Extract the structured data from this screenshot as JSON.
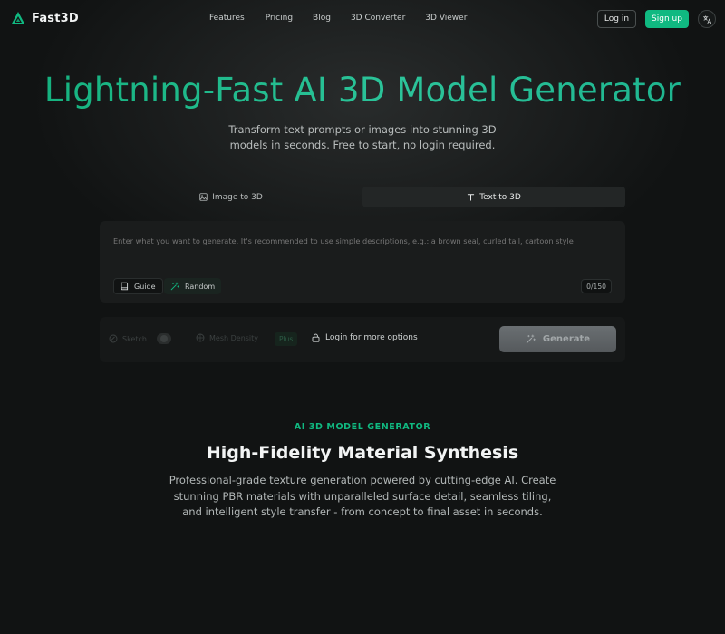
{
  "brand": {
    "name": "Fast3D",
    "logo_icon": "triangle-logo-icon",
    "accent": "#10b981"
  },
  "nav": {
    "links": [
      "Features",
      "Pricing",
      "Blog",
      "3D Converter",
      "3D Viewer"
    ],
    "login_label": "Log in",
    "signup_label": "Sign up",
    "language_icon": "translate-icon"
  },
  "hero": {
    "title": "Lightning-Fast AI 3D Model Generator",
    "subtitle": "Transform text prompts or images into stunning 3D models in seconds. Free to start, no login required."
  },
  "tabs": [
    {
      "label": "Image to 3D",
      "icon": "image-icon",
      "active": false
    },
    {
      "label": "Text to 3D",
      "icon": "text-icon",
      "active": true
    }
  ],
  "prompt": {
    "placeholder": "Enter what you want to generate. It's recommended to use simple descriptions, e.g.: a brown seal, curled tail, cartoon style",
    "value": "",
    "guide_label": "Guide",
    "random_label": "Random",
    "counter": "0/150"
  },
  "options": {
    "sketch_label": "Sketch",
    "mesh_density_label": "Mesh Density",
    "mesh_density_badge": "Plus",
    "login_more_label": "Login for more options",
    "generate_label": "Generate"
  },
  "section": {
    "eyebrow": "AI 3D MODEL GENERATOR",
    "title": "High-Fidelity Material Synthesis",
    "description": "Professional-grade texture generation powered by cutting-edge AI. Create stunning PBR materials with unparalleled surface detail, seamless tiling, and intelligent style transfer - from concept to final asset in seconds."
  }
}
